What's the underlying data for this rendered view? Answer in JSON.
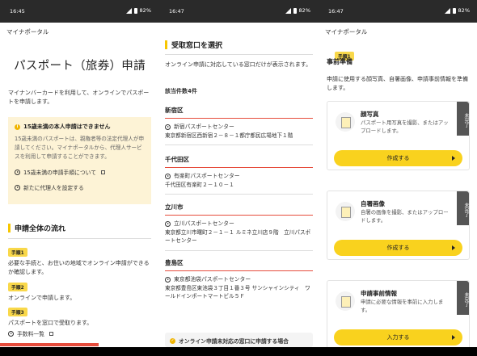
{
  "screens": [
    {
      "status_time": "16:45",
      "battery": "82%",
      "app_bar_title": "マイナポータル",
      "page_title": "パスポート（旅券）申請",
      "intro": "マイナンバーカードを利用して、オンラインでパスポートを申請します。",
      "notice": {
        "title": "15歳未満の本人申請はできません",
        "body": "15歳未満のパスポートは、親権者等の法定代理人が申請してください。マイナポータルから、代理人サービスを利用して申請することができます。",
        "link1": "15歳未満の申請手順について",
        "link2": "新たに代理人を設定する"
      },
      "flow_heading": "申請全体の流れ",
      "steps": [
        {
          "badge": "手順1",
          "text": "必要な手続と、お住いの地域でオンライン申請ができるか確認します。"
        },
        {
          "badge": "手順2",
          "text": "オンラインで申請します。"
        },
        {
          "badge": "手順3",
          "text": "パスポートを窓口で受取ります。"
        }
      ],
      "fee_link": "手数料一覧"
    },
    {
      "status_time": "16:47",
      "battery": "82%",
      "app_bar_title": "",
      "heading": "受取窓口を選択",
      "intro": "オンライン申請に対応している窓口だけが表示されます。",
      "count": "該当件数4件",
      "wards": [
        {
          "name": "新宿区",
          "office": "新宿パスポートセンター",
          "address": "東京都新宿区西新宿２－８－１都庁都民広場地下１階"
        },
        {
          "name": "千代田区",
          "office": "有楽町パスポートセンター",
          "address": "千代田区有楽町２－１０－１"
        },
        {
          "name": "立川市",
          "office": "立川パスポートセンター",
          "address": "東京都立川市曙町２－１－１ ルミネ立川店９階　立川パスポートセンター"
        },
        {
          "name": "豊島区",
          "office": "東京都池袋パスポートセンター",
          "address": "東京都豊島区東池袋３丁目１番３号 サンシャインシティ　ワールドインポートマートビル５Ｆ"
        }
      ],
      "bottom_notice": "オンライン申請未対応の窓口に申請する場合"
    },
    {
      "status_time": "16:47",
      "battery": "82%",
      "app_bar_title": "マイナポータル",
      "step_badge": "手順1",
      "step_title": "事前準備",
      "intro": "申請に使用する顔写真、自署画像、申請事前情報を準備します。",
      "cards": [
        {
          "title": "顔写真",
          "desc": "パスポート用写真を撮影、またはアップロードします。",
          "status": "未完了",
          "button": "作成する",
          "icon": "portrait-photo-icon"
        },
        {
          "title": "自署画像",
          "desc": "自署の画像を撮影、またはアップロードします。",
          "status": "未完了",
          "button": "作成する",
          "icon": "signature-icon"
        },
        {
          "title": "申請事前情報",
          "desc": "申請に必要な情報を事前に入力します。",
          "status": "未完了",
          "button": "入力する",
          "icon": "form-document-icon"
        }
      ]
    }
  ],
  "colors": {
    "accent_yellow": "#f9d21e",
    "notice_bg": "#fdf3d6",
    "red_rule": "#e64c3c",
    "status_gray": "#555555"
  }
}
